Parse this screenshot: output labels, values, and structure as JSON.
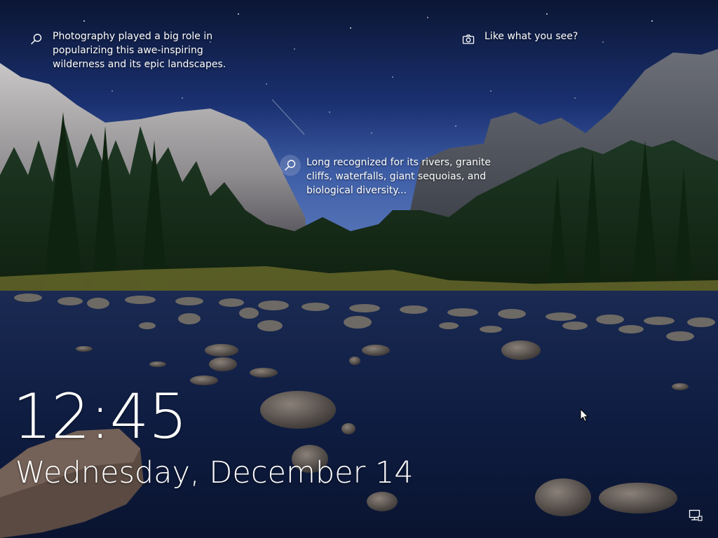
{
  "spotlight": {
    "hint_1": {
      "icon": "search-icon",
      "text": "Photography played a big role in\npopularizing this awe-inspiring\nwilderness and its epic landscapes."
    },
    "hint_2": {
      "icon": "search-icon",
      "text": "Long recognized for its rivers, granite\ncliffs, waterfalls, giant sequoias, and\nbiological diversity..."
    },
    "feedback": {
      "icon": "camera-icon",
      "text": "Like what you see?"
    }
  },
  "clock": {
    "time": "12:45",
    "date": "Wednesday, December 14"
  },
  "tray": {
    "network_icon": "network-icon"
  },
  "colors": {
    "sky_top": "#0c1838",
    "sky_mid": "#1e3a7a",
    "water": "#0e1a3c",
    "text": "#ffffff"
  }
}
